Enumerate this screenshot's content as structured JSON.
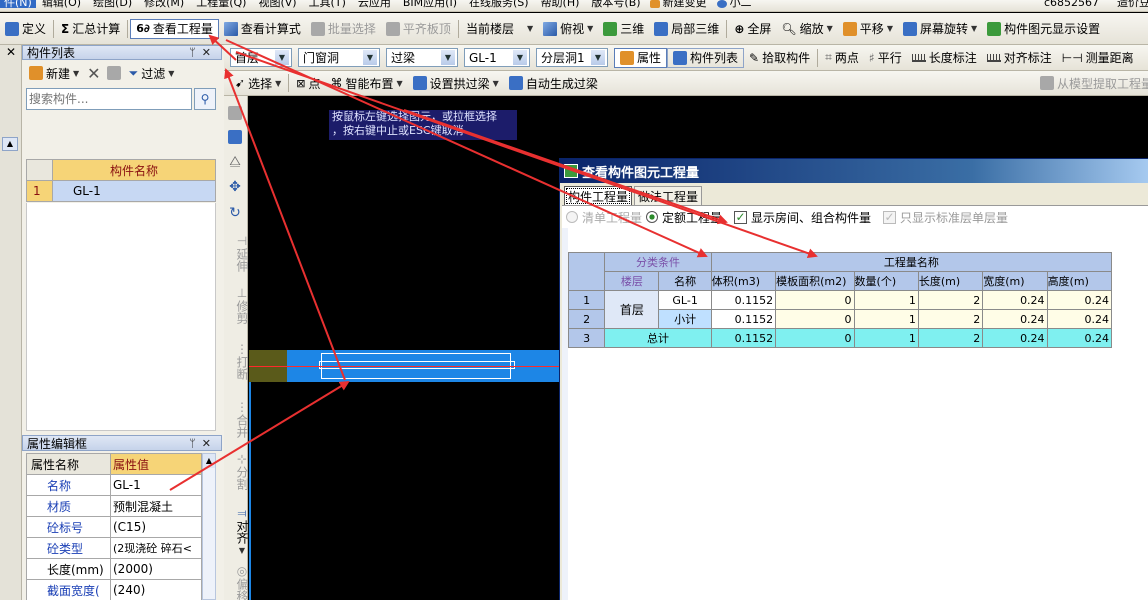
{
  "menu_bar": {
    "items": [
      "件(N)",
      "辑辑(O)",
      "绘图(D)",
      "修改(M)",
      "工程量(Q)",
      "视图(V)",
      "工具(T)",
      "云应用",
      "BIM应用(I)",
      "在线服务(S)",
      "帮助(H)",
      "版本号(B)"
    ],
    "new_change": "新建变更",
    "user_short": "小二",
    "account": "c6852567",
    "right_text": "造价豆：0"
  },
  "toolbar1": {
    "define": "定义",
    "summary": "汇总计算",
    "view_quantity": "查看工程量",
    "view_formula": "查看计算式",
    "batch_select": "批量选择",
    "flush_slab": "平齐板顶",
    "current_floor": "当前楼层",
    "top_view": "俯视",
    "three_d": "三维",
    "local_3d": "局部三维",
    "fullscreen": "全屏",
    "zoom": "缩放",
    "pan": "平移",
    "rotate": "屏幕旋转",
    "element_display": "构件图元显示设置"
  },
  "toolbar2": {
    "floor": "首层",
    "category": "门窗洞",
    "type": "过梁",
    "element": "GL-1",
    "layer": "分层洞1",
    "properties": "属性",
    "element_list": "构件列表",
    "pick": "拾取构件",
    "two_points": "两点",
    "parallel": "平行",
    "length_dim": "长度标注",
    "align_dim": "对齐标注",
    "measure": "测量距离"
  },
  "toolbar3": {
    "select": "选择",
    "point": "点",
    "smart_layout": "智能布置",
    "set_arch": "设置拱过梁",
    "auto_gen": "自动生成过梁",
    "extract_from_model": "从模型提取工程量"
  },
  "component_list": {
    "title": "构件列表",
    "new": "新建",
    "filter": "过滤",
    "search_placeholder": "搜索构件...",
    "col_name": "构件名称",
    "rows": [
      {
        "index": "1",
        "name": "GL-1"
      }
    ]
  },
  "property_panel": {
    "title": "属性编辑框",
    "col_name": "属性名称",
    "col_value": "属性值",
    "rows": [
      {
        "name": "名称",
        "value": "GL-1"
      },
      {
        "name": "材质",
        "value": "预制混凝土"
      },
      {
        "name": "砼标号",
        "value": "(C15)"
      },
      {
        "name": "砼类型",
        "value": "(2现浇砼 碎石<"
      },
      {
        "name": "长度(mm)",
        "value": "(2000)"
      },
      {
        "name": "截面宽度(",
        "value": "(240)"
      }
    ]
  },
  "vertical_tools": [
    "延伸",
    "修剪",
    "打断",
    "合并",
    "分割",
    "对齐",
    "偏移"
  ],
  "canvas": {
    "tooltip_line1": "按鼠标左键选择图元，或拉框选择",
    "tooltip_line2": "，按右键中止或ESC键取消",
    "colors": {
      "background": "#000000",
      "beam_fill": "#1d86e6",
      "beam_end": "#5a5a1a",
      "axis": "#ff2a2a"
    }
  },
  "quantity_dialog": {
    "title": "查看构件图元工程量",
    "tabs": [
      "构件工程量",
      "做法工程量"
    ],
    "options": {
      "list_qty": "清单工程量",
      "quota_qty": "定额工程量",
      "show_rooms": "显示房间、组合构件量",
      "standard_only": "只显示标准层单层量"
    },
    "group_header": "分类条件",
    "qty_header": "工程量名称",
    "col_floor": "楼层",
    "col_name": "名称",
    "columns": [
      "体积(m3)",
      "模板面积(m2)",
      "数量(个)",
      "长度(m)",
      "宽度(m)",
      "高度(m)"
    ],
    "rows": [
      {
        "index": "1",
        "floor": "首层",
        "name": "GL-1",
        "values": [
          "0.1152",
          "0",
          "1",
          "2",
          "0.24",
          "0.24"
        ]
      },
      {
        "index": "2",
        "floor": "",
        "name": "小计",
        "values": [
          "0.1152",
          "0",
          "1",
          "2",
          "0.24",
          "0.24"
        ]
      },
      {
        "index": "3",
        "floor": "",
        "name": "总计",
        "values": [
          "0.1152",
          "0",
          "1",
          "2",
          "0.24",
          "0.24"
        ]
      }
    ]
  }
}
